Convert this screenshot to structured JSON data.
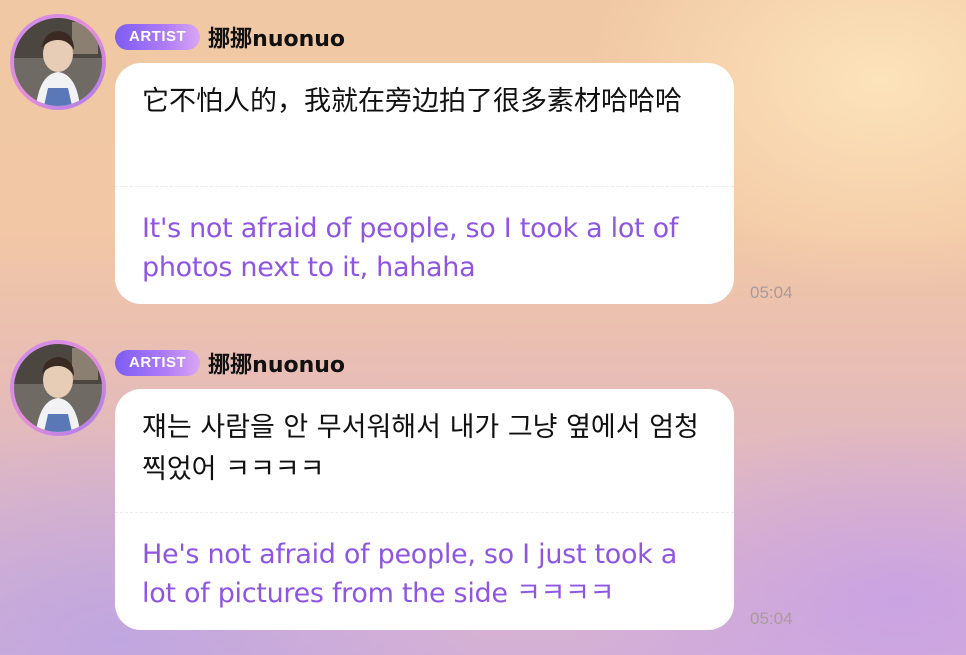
{
  "messages": [
    {
      "badge": "ARTIST",
      "username": "挪挪nuonuo",
      "original": "它不怕人的，我就在旁边拍了很多素材哈哈哈",
      "translation": "It's not afraid of people, so I took a lot of photos next to it, hahaha",
      "time": "05:04"
    },
    {
      "badge": "ARTIST",
      "username": "挪挪nuonuo",
      "original": "쟤는 사람을 안 무서워해서 내가 그냥 옆에서 엄청 찍었어 ㅋㅋㅋㅋ",
      "translation": "He's not afraid of people, so I just took a lot of pictures from the side ㅋㅋㅋㅋ",
      "time": "05:04"
    }
  ],
  "colors": {
    "badge_gradient_start": "#7d5cf5",
    "badge_gradient_end": "#d9a6f3",
    "translation_text": "#8f55e3",
    "timestamp": "#a99b9b",
    "bubble_bg": "#ffffff"
  },
  "icons": {
    "avatar": "profile-photo"
  }
}
